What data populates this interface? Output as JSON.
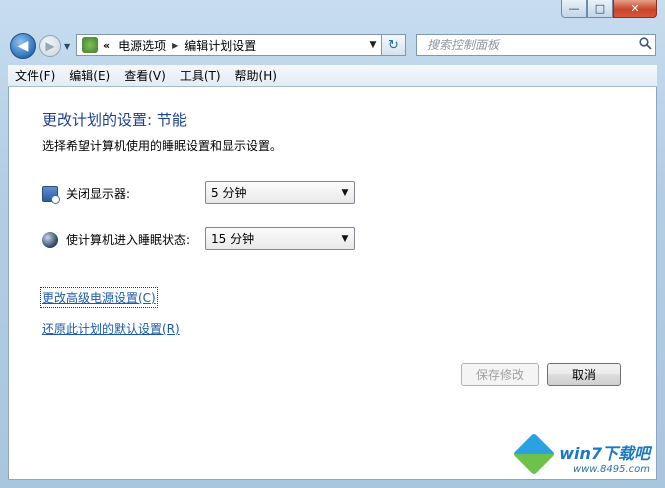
{
  "window": {
    "caption_buttons": {
      "minimize": "—",
      "maximize": "□",
      "close": "✕"
    }
  },
  "nav": {
    "back_glyph": "◀",
    "forward_glyph": "▶",
    "history_glyph": "▼",
    "address": {
      "icon": "control-panel-icon",
      "overflow": "«",
      "segments": [
        "电源选项",
        "编辑计划设置"
      ],
      "separator": "▶",
      "dropdown_glyph": "▼"
    },
    "refresh_glyph": "↻",
    "search": {
      "placeholder": "搜索控制面板",
      "value": "",
      "icon": "search-icon"
    }
  },
  "menu": {
    "items": [
      {
        "label": "文件(F)"
      },
      {
        "label": "编辑(E)"
      },
      {
        "label": "查看(V)"
      },
      {
        "label": "工具(T)"
      },
      {
        "label": "帮助(H)"
      }
    ]
  },
  "content": {
    "title": "更改计划的设置: 节能",
    "subtitle": "选择希望计算机使用的睡眠设置和显示设置。",
    "settings": [
      {
        "icon": "monitor-power-icon",
        "label": "关闭显示器:",
        "value": "5 分钟"
      },
      {
        "icon": "sleep-moon-icon",
        "label": "使计算机进入睡眠状态:",
        "value": "15 分钟"
      }
    ],
    "dropdown_arrow": "▼",
    "links": {
      "advanced": "更改高级电源设置(C)",
      "restore": "还原此计划的默认设置(R)"
    },
    "buttons": {
      "save": "保存修改",
      "cancel": "取消"
    }
  },
  "watermark": {
    "brand": "win7下载吧",
    "url": "www.8495.com"
  },
  "colors": {
    "title_text": "#1e3f8f",
    "link": "#1a5aa8",
    "frame": "#b9d3e8"
  }
}
